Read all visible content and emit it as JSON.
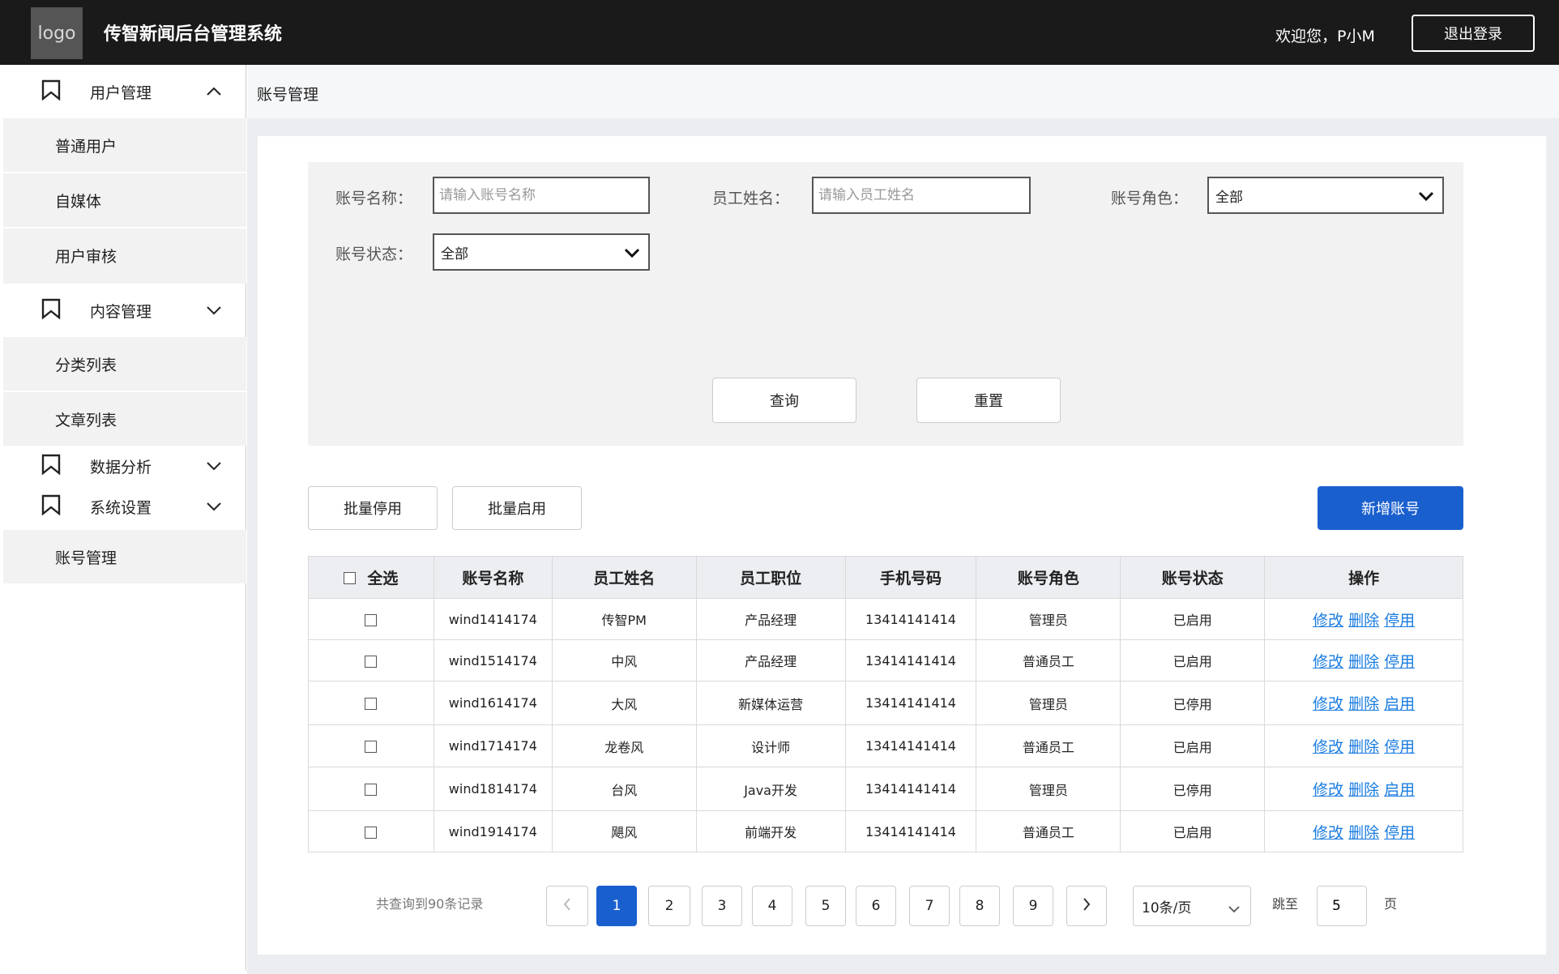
{
  "header": {
    "logo_text": "logo",
    "app_title": "传智新闻后台管理系统",
    "welcome": "欢迎您，P小M",
    "logout_label": "退出登录"
  },
  "sidebar": {
    "groups": [
      {
        "label": "用户管理",
        "expanded": true,
        "icon": "bookmark-icon",
        "items": [
          "普通用户",
          "自媒体",
          "用户审核"
        ]
      },
      {
        "label": "内容管理",
        "expanded": true,
        "icon": "bookmark-icon",
        "items": [
          "分类列表",
          "文章列表"
        ]
      },
      {
        "label": "数据分析",
        "expanded": false,
        "icon": "bookmark-icon",
        "items": []
      },
      {
        "label": "系统设置",
        "expanded": true,
        "icon": "bookmark-icon",
        "items": [
          "账号管理"
        ]
      }
    ]
  },
  "breadcrumb": "账号管理",
  "filters": {
    "account_name_label": "账号名称：",
    "account_name_placeholder": "请输入账号名称",
    "employee_name_label": "员工姓名：",
    "employee_name_placeholder": "请输入员工姓名",
    "role_label": "账号角色：",
    "role_value": "全部",
    "status_label": "账号状态：",
    "status_value": "全部",
    "query_label": "查询",
    "reset_label": "重置"
  },
  "actions": {
    "batch_disable": "批量停用",
    "batch_enable": "批量启用",
    "add_account": "新增账号"
  },
  "table": {
    "select_all": "全选",
    "headers": [
      "账号名称",
      "员工姓名",
      "员工职位",
      "手机号码",
      "账号角色",
      "账号状态",
      "操作"
    ],
    "rows": [
      {
        "account": "wind1414174",
        "name": "传智PM",
        "position": "产品经理",
        "phone": "13414141414",
        "role": "管理员",
        "status": "已启用",
        "actions": [
          "修改",
          "删除",
          "停用"
        ]
      },
      {
        "account": "wind1514174",
        "name": "中风",
        "position": "产品经理",
        "phone": "13414141414",
        "role": "普通员工",
        "status": "已启用",
        "actions": [
          "修改",
          "删除",
          "停用"
        ]
      },
      {
        "account": "wind1614174",
        "name": "大风",
        "position": "新媒体运营",
        "phone": "13414141414",
        "role": "管理员",
        "status": "已停用",
        "actions": [
          "修改",
          "删除",
          "启用"
        ]
      },
      {
        "account": "wind1714174",
        "name": "龙卷风",
        "position": "设计师",
        "phone": "13414141414",
        "role": "普通员工",
        "status": "已启用",
        "actions": [
          "修改",
          "删除",
          "停用"
        ]
      },
      {
        "account": "wind1814174",
        "name": "台风",
        "position": "Java开发",
        "phone": "13414141414",
        "role": "管理员",
        "status": "已停用",
        "actions": [
          "修改",
          "删除",
          "启用"
        ]
      },
      {
        "account": "wind1914174",
        "name": "飓风",
        "position": "前端开发",
        "phone": "13414141414",
        "role": "普通员工",
        "status": "已启用",
        "actions": [
          "修改",
          "删除",
          "停用"
        ]
      }
    ]
  },
  "pagination": {
    "total_text": "共查询到90条记录",
    "pages": [
      "1",
      "2",
      "3",
      "4",
      "5",
      "6",
      "7",
      "8",
      "9"
    ],
    "current_page": "1",
    "page_size": "10条/页",
    "jump_label": "跳至",
    "jump_value": "5",
    "page_suffix": "页"
  },
  "colors": {
    "header_bg": "#1a1a1a",
    "primary": "#1a5fce",
    "link": "#1a7ce0"
  }
}
